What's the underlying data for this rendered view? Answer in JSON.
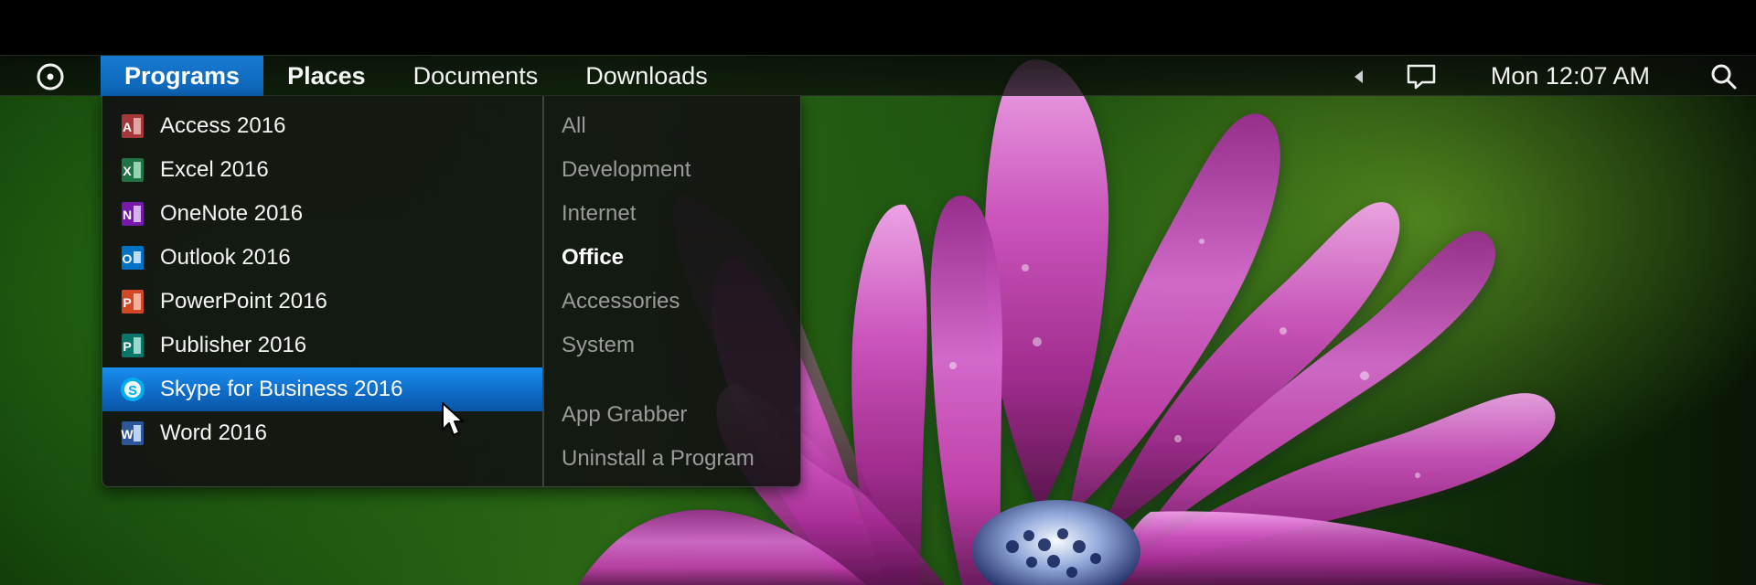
{
  "menubar": {
    "start_icon": "start-circle-icon",
    "items": [
      {
        "label": "Programs",
        "state": "active"
      },
      {
        "label": "Places",
        "state": "normal"
      },
      {
        "label": "Documents",
        "state": "normal"
      },
      {
        "label": "Downloads",
        "state": "normal"
      }
    ],
    "tray": {
      "overflow_icon": "chevron-left-icon",
      "notification_icon": "message-bubble-icon",
      "clock": "Mon 12:07 AM",
      "search_icon": "search-icon"
    }
  },
  "programs": {
    "items": [
      {
        "label": "Access 2016",
        "icon": "access-icon",
        "color": "#a4373a",
        "badge": "A",
        "selected": false
      },
      {
        "label": "Excel 2016",
        "icon": "excel-icon",
        "color": "#217346",
        "badge": "X",
        "selected": false
      },
      {
        "label": "OneNote 2016",
        "icon": "onenote-icon",
        "color": "#7719aa",
        "badge": "N",
        "selected": false
      },
      {
        "label": "Outlook 2016",
        "icon": "outlook-icon",
        "color": "#0072c6",
        "badge": "O",
        "selected": false
      },
      {
        "label": "PowerPoint 2016",
        "icon": "powerpoint-icon",
        "color": "#d24726",
        "badge": "P",
        "selected": false
      },
      {
        "label": "Publisher 2016",
        "icon": "publisher-icon",
        "color": "#077568",
        "badge": "P",
        "selected": false
      },
      {
        "label": "Skype for Business 2016",
        "icon": "skype-icon",
        "color": "#00aff0",
        "badge": "S",
        "selected": true
      },
      {
        "label": "Word 2016",
        "icon": "word-icon",
        "color": "#2b579a",
        "badge": "W",
        "selected": false
      }
    ]
  },
  "categories": {
    "items": [
      {
        "label": "All",
        "active": false
      },
      {
        "label": "Development",
        "active": false
      },
      {
        "label": "Internet",
        "active": false
      },
      {
        "label": "Office",
        "active": true
      },
      {
        "label": "Accessories",
        "active": false
      },
      {
        "label": "System",
        "active": false
      }
    ],
    "actions": [
      {
        "label": "App Grabber"
      },
      {
        "label": "Uninstall a Program"
      }
    ]
  },
  "colors": {
    "accent_blue": "#0f6cc8",
    "menubar_bg": "#080a08",
    "flower_magenta": "#c43fae",
    "flower_light": "#f0b4ec",
    "leaf_green": "#2c6a16"
  }
}
